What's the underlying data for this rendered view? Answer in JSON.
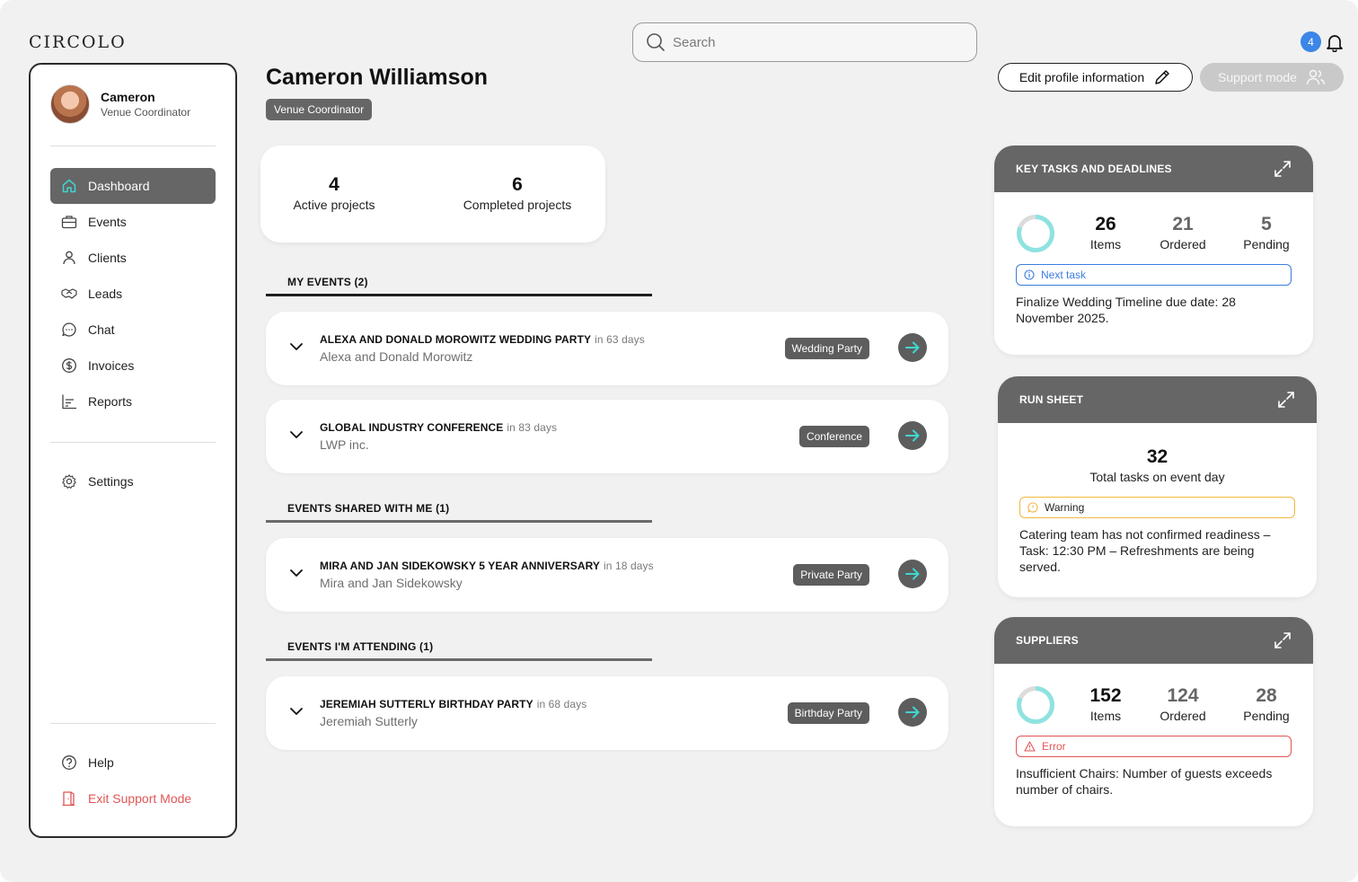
{
  "app": {
    "logo": "CIRCOLO"
  },
  "search": {
    "placeholder": "Search"
  },
  "notifications": {
    "count": "4"
  },
  "user": {
    "name": "Cameron",
    "role": "Venue Coordinator"
  },
  "nav": {
    "items": [
      {
        "label": "Dashboard",
        "icon": "home-icon",
        "active": true
      },
      {
        "label": "Events",
        "icon": "briefcase-icon"
      },
      {
        "label": "Clients",
        "icon": "user-icon"
      },
      {
        "label": "Leads",
        "icon": "handshake-icon"
      },
      {
        "label": "Chat",
        "icon": "chat-icon"
      },
      {
        "label": "Invoices",
        "icon": "dollar-icon"
      },
      {
        "label": "Reports",
        "icon": "bar-chart-icon"
      }
    ],
    "settings": "Settings",
    "help": "Help",
    "exit": "Exit Support Mode"
  },
  "header": {
    "title": "Cameron Williamson",
    "role_chip": "Venue Coordinator",
    "edit_label": "Edit profile information",
    "support_label": "Support mode"
  },
  "stats": {
    "active": {
      "value": "4",
      "label": "Active projects"
    },
    "completed": {
      "value": "6",
      "label": "Completed projects"
    }
  },
  "sections": {
    "my_events": "MY EVENTS (2)",
    "shared": "EVENTS SHARED WITH ME (1)",
    "attending": "EVENTS I'M ATTENDING (1)"
  },
  "events": [
    {
      "title": "ALEXA AND DONALD  MOROWITZ WEDDING PARTY",
      "days": "in 63 days",
      "client": "Alexa and Donald Morowitz",
      "tag": "Wedding Party"
    },
    {
      "title": "GLOBAL INDUSTRY CONFERENCE",
      "days": "in 83 days",
      "client": "LWP inc.",
      "tag": "Conference"
    },
    {
      "title": "MIRA AND JAN  SIDEKOWSKY 5 YEAR ANNIVERSARY",
      "days": "in 18 days",
      "client": "Mira and Jan Sidekowsky",
      "tag": "Private Party"
    },
    {
      "title": "JEREMIAH SUTTERLY BIRTHDAY PARTY",
      "days": "in 68 days",
      "client": "Jeremiah Sutterly",
      "tag": "Birthday Party"
    }
  ],
  "key_tasks": {
    "title": "KEY TASKS AND DEADLINES",
    "items": {
      "value": "26",
      "label": "Items"
    },
    "ordered": {
      "value": "21",
      "label": "Ordered"
    },
    "pending": {
      "value": "5",
      "label": "Pending"
    },
    "alert": "Next task",
    "text": "Finalize Wedding Timeline due date: 28 November 2025."
  },
  "run_sheet": {
    "title": "RUN SHEET",
    "value": "32",
    "label": "Total tasks on event day",
    "alert": "Warning",
    "text": "Catering team has not confirmed readiness – Task: 12:30 PM – Refreshments are being served."
  },
  "suppliers": {
    "title": "SUPPLIERS",
    "items": {
      "value": "152",
      "label": "Items"
    },
    "ordered": {
      "value": "124",
      "label": "Ordered"
    },
    "pending": {
      "value": "28",
      "label": "Pending"
    },
    "alert": "Error",
    "text": "Insufficient Chairs: Number of guests exceeds number of chairs."
  },
  "colors": {
    "accent": "#3fd6d0",
    "info": "#3b7de0",
    "warning": "#f0b840",
    "error": "#e05555",
    "dark": "#666666"
  }
}
